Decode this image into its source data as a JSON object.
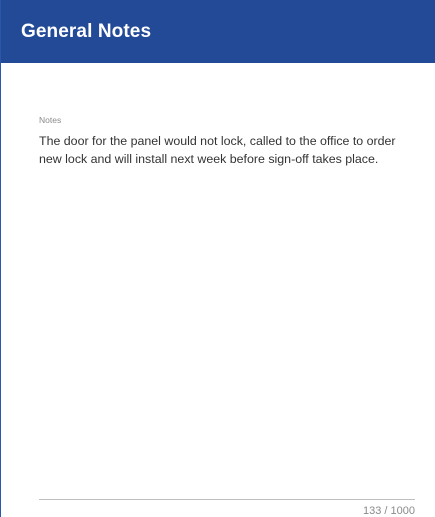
{
  "header": {
    "title": "General Notes",
    "color": "#234a97"
  },
  "notes": {
    "label": "Notes",
    "value": "The door for the panel would not lock, called to the office to order\nnew lock and will install next week before sign-off takes place.",
    "char_count": "133 / 1000"
  }
}
